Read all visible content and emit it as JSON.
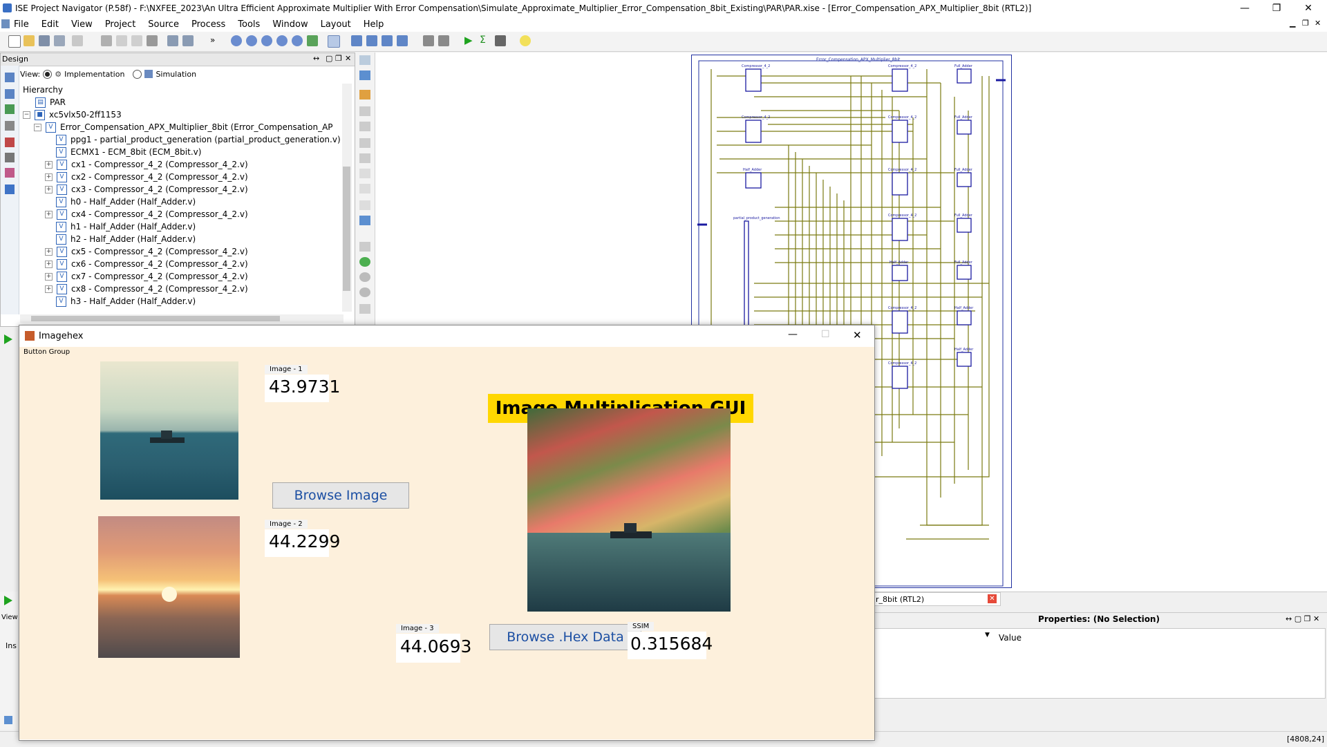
{
  "window": {
    "title": "ISE Project Navigator (P.58f) - F:\\NXFEE_2023\\An Ultra Efficient Approximate Multiplier With Error Compensation\\Simulate_Approximate_Multiplier_Error_Compensation_8bit_Existing\\PAR\\PAR.xise - [Error_Compensation_APX_Multiplier_8bit (RTL2)]",
    "minimize": "—",
    "maximize": "❐",
    "close": "✕"
  },
  "menu": [
    "File",
    "Edit",
    "View",
    "Project",
    "Source",
    "Process",
    "Tools",
    "Window",
    "Layout",
    "Help"
  ],
  "design_panel": {
    "title": "Design",
    "view_label": "View:",
    "view_impl": "Implementation",
    "view_sim": "Simulation",
    "hierarchy_label": "Hierarchy",
    "items": [
      "PAR",
      "xc5vlx50-2ff1153",
      "Error_Compensation_APX_Multiplier_8bit (Error_Compensation_AP",
      "ppg1 - partial_product_generation (partial_product_generation.v)",
      "ECMX1 - ECM_8bit (ECM_8bit.v)",
      "cx1 - Compressor_4_2 (Compressor_4_2.v)",
      "cx2 - Compressor_4_2 (Compressor_4_2.v)",
      "cx3 - Compressor_4_2 (Compressor_4_2.v)",
      "h0 - Half_Adder (Half_Adder.v)",
      "cx4 - Compressor_4_2 (Compressor_4_2.v)",
      "h1 - Half_Adder (Half_Adder.v)",
      "h2 - Half_Adder (Half_Adder.v)",
      "cx5 - Compressor_4_2 (Compressor_4_2.v)",
      "cx6 - Compressor_4_2 (Compressor_4_2.v)",
      "cx7 - Compressor_4_2 (Compressor_4_2.v)",
      "cx8 - Compressor_4_2 (Compressor_4_2.v)",
      "h3 - Half_Adder (Half_Adder.v)"
    ]
  },
  "schematic": {
    "sheet_title": "Error_Compensation_APX_Multiplier_8bit",
    "blocks": [
      "Compressor_4_2",
      "Compressor_4_2",
      "Full_Adder",
      "Compressor_4_2",
      "Compressor_4_2",
      "Full_Adder",
      "Half_Adder",
      "Compressor_4_2",
      "Full_Adder",
      "partial_product_generation",
      "Compressor_4_2",
      "Full_Adder",
      "Half_Adder",
      "Full_Adder",
      "Compressor_4_2",
      "Half_Adder",
      "Half_Adder",
      "Compressor_4_2"
    ],
    "tab_label": "r_8bit (RTL2)"
  },
  "properties": {
    "title": "Properties: (No Selection)",
    "value_col": "Value"
  },
  "left_bottom": {
    "view": "View",
    "ins": "Ins"
  },
  "status": {
    "coords": "[4808,24]"
  },
  "imagehex": {
    "title": "Imagehex",
    "group_label": "Button Group",
    "gui_title": "Image Multiplication GUI",
    "image1_label": "Image - 1",
    "image1_value": "43.9731",
    "image2_label": "Image - 2",
    "image2_value": "44.2299",
    "image3_label": "Image - 3",
    "image3_value": "44.0693",
    "ssim_label": "SSIM",
    "ssim_value": "0.315684",
    "browse_image": "Browse Image",
    "browse_hex": "Browse .Hex Data"
  },
  "colors": {
    "gui_title_bg": "#ffd700",
    "window_bg": "#fdf0dc",
    "button_text": "#1c4fa3",
    "wire": "#7a7a10",
    "block": "#1a1aa0"
  }
}
